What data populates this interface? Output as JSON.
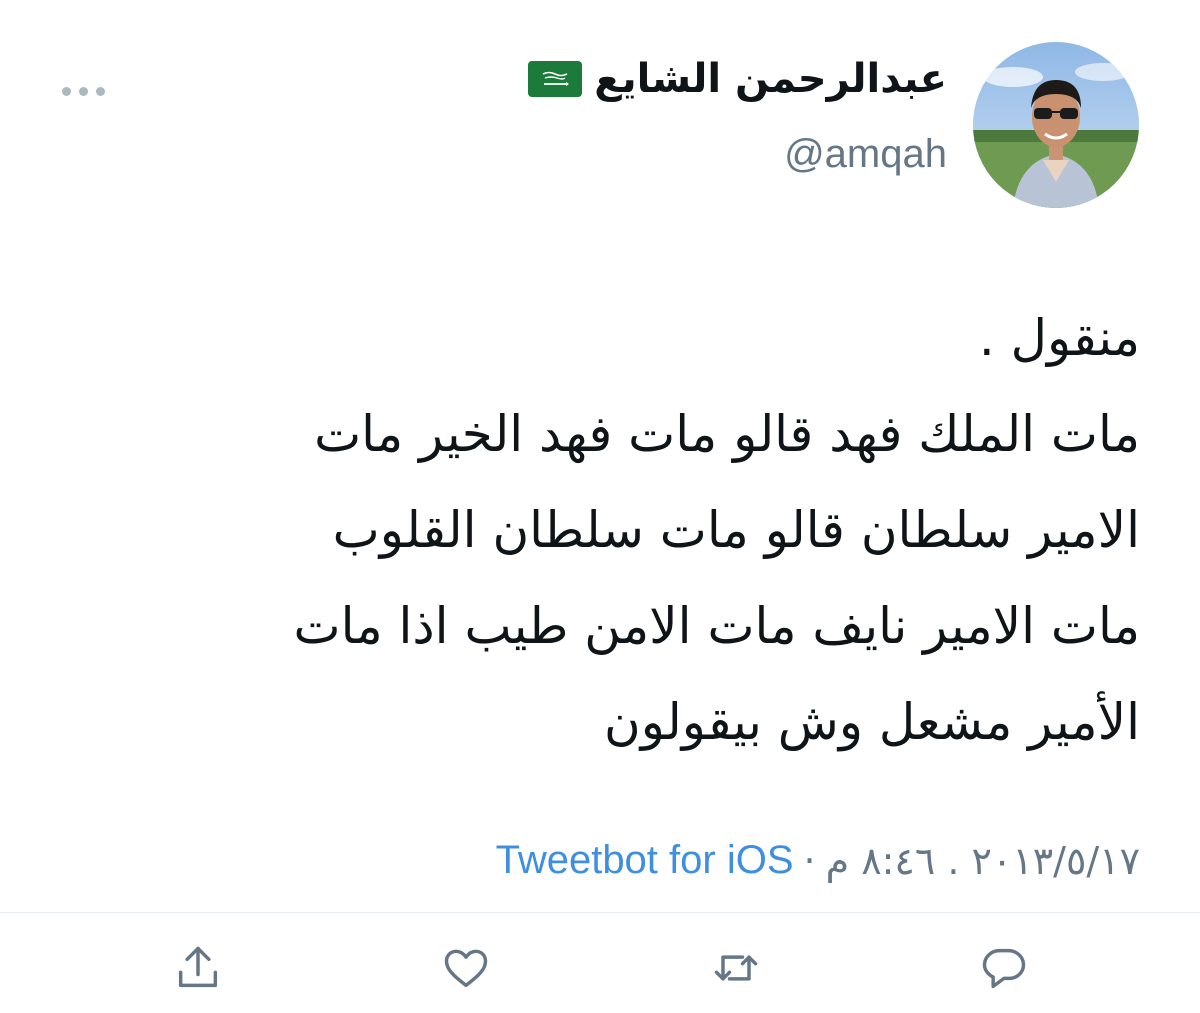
{
  "tweet": {
    "display_name": "عبدالرحمن الشايع",
    "flag_text": "لا إله إلا الله",
    "handle": "@amqah",
    "text": "منقول .\nمات الملك فهد قالو مات فهد الخير مات\nالامير سلطان قالو مات سلطان القلوب\nمات الامير نايف مات الامن طيب اذا مات\nالأمير مشعل وش بيقولون",
    "timestamp": "٢٠١٣/٥/١٧ . ٨:٤٦ م",
    "separator": "·",
    "source": "Tweetbot for iOS"
  },
  "colors": {
    "link": "#3f8fe0",
    "muted": "#657786",
    "icon": "#657786",
    "flag_green": "#1c7b3a"
  },
  "icons": {
    "more": "more-dots-icon",
    "share": "share-icon",
    "like": "heart-icon",
    "retweet": "retweet-icon",
    "reply": "reply-icon"
  }
}
